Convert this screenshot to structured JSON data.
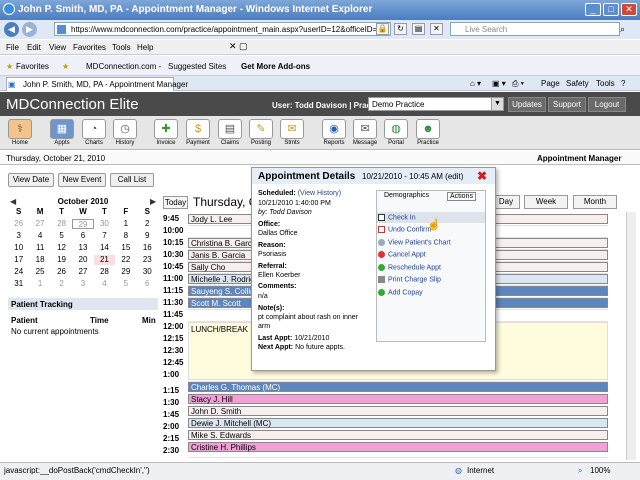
{
  "browser": {
    "title": "John P. Smith, MD, PA - Appointment Manager - Windows Internet Explorer",
    "url": "https://www.mdconnection.com/practice/appointment_main.aspx?userID=12&officeID=3",
    "search_placeholder": "Live Search",
    "menu": [
      "File",
      "Edit",
      "View",
      "Favorites",
      "Tools",
      "Help"
    ],
    "favorites_label": "Favorites",
    "fav_links": [
      "MDConnection.com -",
      "Suggested Sites",
      "Get More Add-ons"
    ],
    "tab_title": "John P. Smith, MD, PA - Appointment Manager",
    "right_tools": [
      "Page",
      "Safety",
      "Tools"
    ],
    "status": "javascript:__doPostBack('cmdCheckIn','')",
    "zone": "Internet",
    "zoom": "100%"
  },
  "app": {
    "name": "MDConnection Elite",
    "user_label": "User: Todd Davison | Practice:",
    "practice": "Demo Practice",
    "header_buttons": [
      "Updates",
      "Support",
      "Logout"
    ],
    "toolbar": [
      "Home",
      "Appts",
      "Charts",
      "History",
      "Invoice",
      "Payment",
      "Claims",
      "Posting",
      "Stmts",
      "Reports",
      "Message",
      "Portal",
      "Practice"
    ],
    "date": "Thursday, October 21, 2010",
    "module": "Appointment Manager"
  },
  "left": {
    "buttons": [
      "View Date",
      "New Event",
      "Call List"
    ],
    "calendar": {
      "month": "October 2010",
      "days_header": [
        "S",
        "M",
        "T",
        "W",
        "T",
        "F",
        "S"
      ],
      "cells": [
        "26",
        "27",
        "28",
        "29",
        "30",
        "1",
        "2",
        "3",
        "4",
        "5",
        "6",
        "7",
        "8",
        "9",
        "10",
        "11",
        "12",
        "13",
        "14",
        "15",
        "16",
        "17",
        "18",
        "19",
        "20",
        "21",
        "22",
        "23",
        "24",
        "25",
        "26",
        "27",
        "28",
        "29",
        "30",
        "31",
        "1",
        "2",
        "3",
        "4",
        "5",
        "6"
      ]
    },
    "tracking": {
      "title": "Patient Tracking",
      "cols": [
        "Patient",
        "Time",
        "Min"
      ],
      "empty": "No current appointments"
    }
  },
  "schedule": {
    "today_btn": "Today",
    "title": "Thursday, October 21, 2010",
    "view_buttons": [
      "Day",
      "Week",
      "Month"
    ],
    "times": [
      "9:45",
      "10:00",
      "10:15",
      "10:30",
      "10:45",
      "11:00",
      "11:15",
      "11:30",
      "11:45",
      "12:00",
      "12:15",
      "12:30",
      "12:45",
      "1:00",
      "1:15",
      "1:30",
      "1:45",
      "2:00",
      "2:15",
      "2:30",
      "2:45",
      "3:00"
    ],
    "appointments": [
      "Jody L. Lee",
      "Christina B. Garcia",
      "Janis B. Garcia",
      "Sally Cho",
      "Michelle J. Rodriguez",
      "Sauyeng S. Collins",
      "Scott M. Scott",
      "Charles G. Thomas (MC)",
      "Stacy J. Hill",
      "John D. Smith",
      "Dewie J. Mitchell (MC)",
      "Mike S. Edwards",
      "Cristine H. Phillips"
    ],
    "lunch": "LUNCH/BREAK"
  },
  "popup": {
    "title": "Appointment Details",
    "date": "10/21/2010 - 10:45 AM (edit)",
    "scheduled_label": "Scheduled:",
    "scheduled_link": "(View History)",
    "scheduled_date": "10/21/2010 1:40:00 PM",
    "scheduled_by": "by: Todd Davison",
    "office_label": "Office:",
    "office": "Dallas Office",
    "reason_label": "Reason:",
    "reason": "Psoriasis",
    "referral_label": "Referral:",
    "referral": "Ellen Koerber",
    "comments_label": "Comments:",
    "comments": "n/a",
    "notes_label": "Note(s):",
    "notes_1": "pt complaint about rash on inner",
    "notes_2": "arm",
    "last_label": "Last Appt:",
    "last": "10/21/2010",
    "next_label": "Next Appt:",
    "next": "No future appts.",
    "tabs": [
      "Demographics",
      "Actions"
    ],
    "actions": [
      "Check In",
      "Undo Confirm",
      "View Patient's Chart",
      "Cancel Appt",
      "Reschedule Appt",
      "Print Charge Slip",
      "Add Copay"
    ]
  }
}
